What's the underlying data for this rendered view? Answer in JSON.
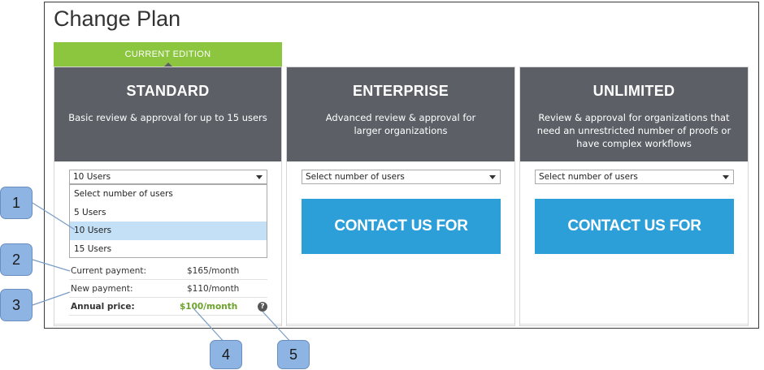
{
  "page": {
    "title": "Change Plan"
  },
  "current_tab": {
    "label": "CURRENT EDITION"
  },
  "plans": [
    {
      "name": "STANDARD",
      "description": "Basic review & approval for up to 15 users",
      "select_value": "10 Users",
      "dropdown_options": [
        "Select number of users",
        "5 Users",
        "10 Users",
        "15 Users"
      ],
      "selected_option": "10 Users",
      "current_payment_label": "Current payment:",
      "current_payment_value": "$165/month",
      "new_payment_label": "New payment:",
      "new_payment_value": "$110/month",
      "annual_label": "Annual price:",
      "annual_value": "$100/month",
      "help_icon": "?"
    },
    {
      "name": "ENTERPRISE",
      "description": "Advanced review & approval for larger organizations",
      "select_value": "Select number of users",
      "cta": "CONTACT US FOR PRICING"
    },
    {
      "name": "UNLIMITED",
      "description": "Review & approval for organizations that need an unrestricted number of proofs or have complex workflows",
      "select_value": "Select number of users",
      "cta": "CONTACT US FOR PRICING"
    }
  ],
  "callouts": [
    "1",
    "2",
    "3",
    "4",
    "5"
  ],
  "colors": {
    "current_tab": "#8cc63f",
    "plan_header": "#5c6066",
    "cta": "#2c9fd9",
    "annual_price": "#6aa22a",
    "callout": "#8db4e2",
    "selected_option": "#c4e0f7"
  }
}
